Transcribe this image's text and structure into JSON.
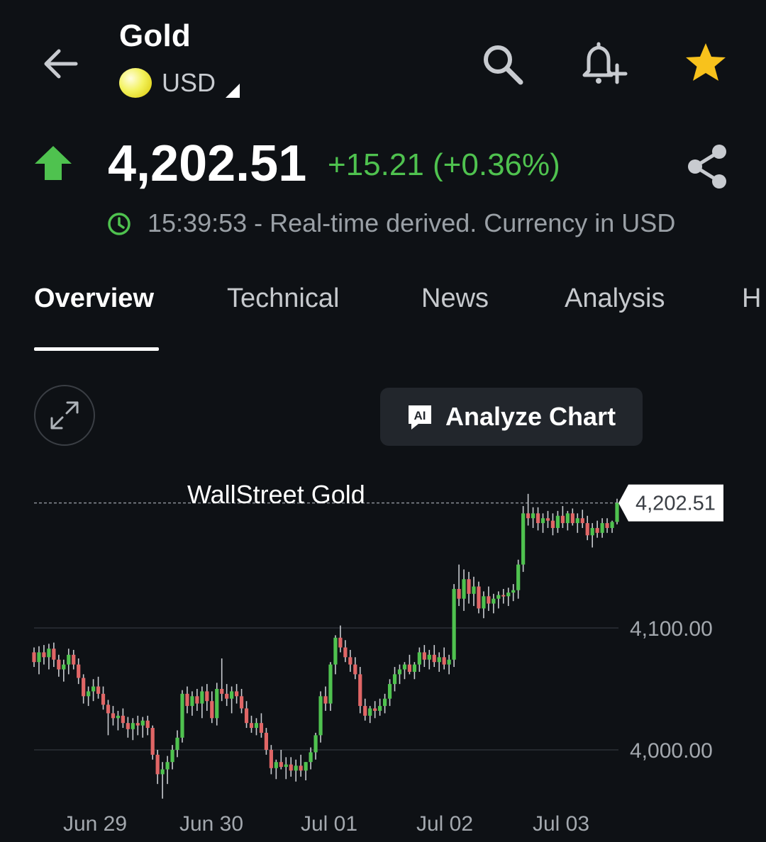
{
  "header": {
    "title": "Gold",
    "currency": "USD",
    "icons": {
      "back": "arrow-left-icon",
      "search": "search-icon",
      "alert": "bell-plus-icon",
      "favorite": "star-icon",
      "share": "share-icon"
    }
  },
  "quote": {
    "direction": "up",
    "price": "4,202.51",
    "change": "+15.21 (+0.36%)",
    "timestamp": "15:39:53 - Real-time derived. Currency in USD"
  },
  "tabs": [
    {
      "label": "Overview",
      "active": true
    },
    {
      "label": "Technical",
      "active": false
    },
    {
      "label": "News",
      "active": false
    },
    {
      "label": "Analysis",
      "active": false
    },
    {
      "label": "H",
      "active": false
    }
  ],
  "toolbar": {
    "analyze_label": "Analyze Chart",
    "ai_badge": "AI"
  },
  "colors": {
    "up": "#4fc24f",
    "down": "#e06666",
    "star": "#f8c21c",
    "background": "#0e1115"
  },
  "chart_data": {
    "type": "candlestick",
    "title": "WallStreet Gold",
    "last_price_label": "4,202.51",
    "last_price": 4202.51,
    "y_tick_labels": [
      "4,100.00",
      "4,000.00"
    ],
    "y_ticks": [
      4100,
      4000
    ],
    "ylim": [
      3955,
      4220
    ],
    "x_labels": [
      "Jun 29",
      "Jun 30",
      "Jul 01",
      "Jul 02",
      "Jul 03"
    ],
    "grid": true,
    "candles": [
      [
        4080,
        4084,
        4068,
        4072
      ],
      [
        4072,
        4085,
        4062,
        4080
      ],
      [
        4080,
        4086,
        4070,
        4076
      ],
      [
        4076,
        4087,
        4066,
        4083
      ],
      [
        4083,
        4088,
        4068,
        4074
      ],
      [
        4074,
        4078,
        4060,
        4066
      ],
      [
        4066,
        4074,
        4056,
        4070
      ],
      [
        4070,
        4083,
        4062,
        4078
      ],
      [
        4078,
        4082,
        4066,
        4070
      ],
      [
        4070,
        4075,
        4054,
        4059
      ],
      [
        4059,
        4062,
        4038,
        4044
      ],
      [
        4044,
        4052,
        4036,
        4048
      ],
      [
        4048,
        4058,
        4040,
        4052
      ],
      [
        4052,
        4060,
        4042,
        4046
      ],
      [
        4046,
        4052,
        4033,
        4037
      ],
      [
        4037,
        4041,
        4012,
        4030
      ],
      [
        4030,
        4036,
        4020,
        4026
      ],
      [
        4026,
        4032,
        4016,
        4028
      ],
      [
        4028,
        4034,
        4018,
        4022
      ],
      [
        4022,
        4027,
        4010,
        4017
      ],
      [
        4017,
        4026,
        4008,
        4022
      ],
      [
        4022,
        4028,
        4012,
        4020
      ],
      [
        4020,
        4027,
        4010,
        4024
      ],
      [
        4024,
        4028,
        4012,
        4018
      ],
      [
        4018,
        4020,
        3992,
        3996
      ],
      [
        3996,
        4000,
        3972,
        3980
      ],
      [
        3980,
        3990,
        3960,
        3984
      ],
      [
        3984,
        3995,
        3972,
        3990
      ],
      [
        3990,
        4004,
        3984,
        4000
      ],
      [
        4000,
        4016,
        3994,
        4010
      ],
      [
        4010,
        4049,
        4006,
        4046
      ],
      [
        4046,
        4052,
        4030,
        4036
      ],
      [
        4036,
        4048,
        4028,
        4044
      ],
      [
        4044,
        4050,
        4032,
        4038
      ],
      [
        4038,
        4052,
        4026,
        4048
      ],
      [
        4048,
        4054,
        4032,
        4040
      ],
      [
        4040,
        4048,
        4022,
        4026
      ],
      [
        4026,
        4055,
        4020,
        4050
      ],
      [
        4050,
        4075,
        4040,
        4046
      ],
      [
        4046,
        4054,
        4036,
        4042
      ],
      [
        4042,
        4052,
        4030,
        4048
      ],
      [
        4048,
        4054,
        4038,
        4044
      ],
      [
        4044,
        4050,
        4030,
        4034
      ],
      [
        4034,
        4040,
        4018,
        4022
      ],
      [
        4022,
        4028,
        4014,
        4018
      ],
      [
        4018,
        4026,
        4012,
        4022
      ],
      [
        4022,
        4030,
        4010,
        4014
      ],
      [
        4014,
        4018,
        3996,
        4000
      ],
      [
        4000,
        4004,
        3980,
        3985
      ],
      [
        3985,
        3992,
        3976,
        3990
      ],
      [
        3990,
        4000,
        3984,
        3986
      ],
      [
        3986,
        3994,
        3976,
        3988
      ],
      [
        3988,
        3994,
        3978,
        3983
      ],
      [
        3983,
        3992,
        3974,
        3987
      ],
      [
        3987,
        3996,
        3978,
        3983
      ],
      [
        3983,
        3990,
        3975,
        3990
      ],
      [
        3990,
        4002,
        3984,
        3998
      ],
      [
        3998,
        4014,
        3992,
        4012
      ],
      [
        4012,
        4048,
        4006,
        4044
      ],
      [
        4044,
        4052,
        4032,
        4038
      ],
      [
        4038,
        4072,
        4032,
        4070
      ],
      [
        4070,
        4094,
        4062,
        4092
      ],
      [
        4092,
        4102,
        4080,
        4084
      ],
      [
        4084,
        4090,
        4072,
        4076
      ],
      [
        4076,
        4082,
        4064,
        4070
      ],
      [
        4070,
        4076,
        4058,
        4062
      ],
      [
        4062,
        4068,
        4030,
        4036
      ],
      [
        4036,
        4042,
        4024,
        4028
      ],
      [
        4028,
        4036,
        4022,
        4034
      ],
      [
        4034,
        4040,
        4026,
        4032
      ],
      [
        4032,
        4042,
        4028,
        4036
      ],
      [
        4036,
        4046,
        4030,
        4042
      ],
      [
        4042,
        4058,
        4036,
        4054
      ],
      [
        4054,
        4068,
        4048,
        4062
      ],
      [
        4062,
        4070,
        4054,
        4066
      ],
      [
        4066,
        4072,
        4058,
        4070
      ],
      [
        4070,
        4078,
        4062,
        4064
      ],
      [
        4064,
        4072,
        4058,
        4070
      ],
      [
        4070,
        4084,
        4064,
        4080
      ],
      [
        4080,
        4086,
        4068,
        4074
      ],
      [
        4074,
        4082,
        4066,
        4078
      ],
      [
        4078,
        4086,
        4068,
        4072
      ],
      [
        4072,
        4080,
        4064,
        4076
      ],
      [
        4076,
        4084,
        4066,
        4070
      ],
      [
        4070,
        4078,
        4062,
        4074
      ],
      [
        4074,
        4136,
        4068,
        4132
      ],
      [
        4132,
        4152,
        4118,
        4124
      ],
      [
        4124,
        4148,
        4114,
        4140
      ],
      [
        4140,
        4146,
        4120,
        4128
      ],
      [
        4128,
        4142,
        4118,
        4134
      ],
      [
        4134,
        4138,
        4112,
        4116
      ],
      [
        4116,
        4130,
        4108,
        4126
      ],
      [
        4126,
        4134,
        4114,
        4120
      ],
      [
        4120,
        4128,
        4112,
        4124
      ],
      [
        4124,
        4130,
        4116,
        4127
      ],
      [
        4127,
        4132,
        4120,
        4126
      ],
      [
        4126,
        4133,
        4118,
        4129
      ],
      [
        4129,
        4136,
        4122,
        4131
      ],
      [
        4131,
        4156,
        4124,
        4152
      ],
      [
        4152,
        4200,
        4146,
        4194
      ],
      [
        4194,
        4210,
        4184,
        4190
      ],
      [
        4190,
        4199,
        4182,
        4194
      ],
      [
        4194,
        4199,
        4180,
        4186
      ],
      [
        4186,
        4194,
        4178,
        4190
      ],
      [
        4190,
        4196,
        4182,
        4188
      ],
      [
        4188,
        4194,
        4176,
        4182
      ],
      [
        4182,
        4196,
        4178,
        4192
      ],
      [
        4192,
        4200,
        4182,
        4186
      ],
      [
        4186,
        4196,
        4180,
        4194
      ],
      [
        4194,
        4198,
        4184,
        4186
      ],
      [
        4186,
        4194,
        4178,
        4190
      ],
      [
        4190,
        4197,
        4182,
        4186
      ],
      [
        4186,
        4192,
        4172,
        4176
      ],
      [
        4176,
        4186,
        4166,
        4182
      ],
      [
        4182,
        4188,
        4174,
        4178
      ],
      [
        4178,
        4190,
        4174,
        4186
      ],
      [
        4186,
        4190,
        4178,
        4182
      ],
      [
        4182,
        4188,
        4178,
        4187
      ],
      [
        4187,
        4206,
        4185,
        4202.51
      ]
    ]
  }
}
